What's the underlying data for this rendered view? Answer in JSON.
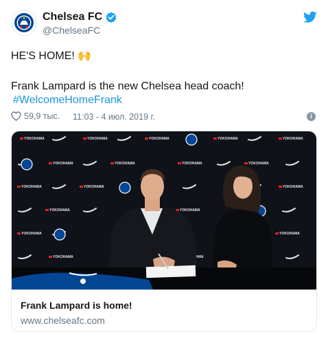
{
  "account": {
    "name": "Chelsea FC",
    "handle": "@ChelseaFC"
  },
  "tweet": {
    "line1": "HE'S HOME! 🙌",
    "line2": "Frank Lampard is the new Chelsea head coach!",
    "hashtag": "#WelcomeHomeFrank",
    "likes": "59,9 тыс.",
    "timestamp": "11:03 - 4 июл. 2019 г."
  },
  "card": {
    "title": "Frank Lampard is home!",
    "url": "www.chelseafc.com"
  },
  "colors": {
    "link": "#1b95e0",
    "secondary": "#657786",
    "border": "#e1e8ed",
    "chelsea_blue": "#034694",
    "sponsor_red": "#e1251b"
  },
  "icons": [
    "chelsea-crest-icon",
    "verified-badge-icon",
    "twitter-bird-icon",
    "heart-icon",
    "info-icon"
  ]
}
